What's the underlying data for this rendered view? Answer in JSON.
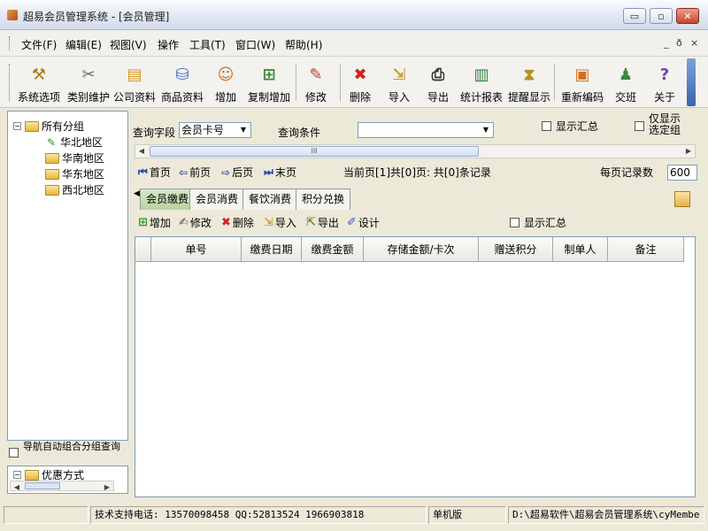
{
  "window": {
    "title": "超易会员管理系统 - [会员管理]",
    "controls": {
      "minimize": "▭",
      "restore": "▫",
      "close": "✕"
    }
  },
  "menu": {
    "items": [
      "文件(F)",
      "编辑(E)",
      "视图(V)",
      "操作",
      "工具(T)",
      "窗口(W)",
      "帮助(H)"
    ],
    "mdi_controls": [
      "_",
      "ð",
      "×"
    ]
  },
  "toolbar": {
    "buttons": [
      {
        "label": "系统选项",
        "icon": "hammer-icon"
      },
      {
        "label": "类别维护",
        "icon": "tools-icon"
      },
      {
        "label": "公司资料",
        "icon": "company-icon"
      },
      {
        "label": "商品资料",
        "icon": "goods-icon"
      },
      {
        "label": "增加",
        "icon": "add-user-icon"
      },
      {
        "label": "复制增加",
        "icon": "copy-add-icon"
      },
      {
        "label": "修改",
        "icon": "pencil-icon"
      },
      {
        "label": "删除",
        "icon": "delete-x-icon"
      },
      {
        "label": "导入",
        "icon": "import-icon"
      },
      {
        "label": "导出",
        "icon": "printer-icon"
      },
      {
        "label": "统计报表",
        "icon": "chart-icon"
      },
      {
        "label": "提醒显示",
        "icon": "reminder-icon"
      },
      {
        "label": "重新编码",
        "icon": "recode-icon"
      },
      {
        "label": "交班",
        "icon": "handover-icon"
      },
      {
        "label": "关于",
        "icon": "help-question-icon"
      }
    ]
  },
  "tree": {
    "root": "所有分组",
    "children": [
      "华北地区",
      "华南地区",
      "华东地区",
      "西北地区"
    ]
  },
  "nav_checkbox": {
    "label": "导航自动组合分组查询"
  },
  "lower_tree": {
    "root": "优惠方式"
  },
  "query": {
    "field_label": "查询字段",
    "field_value": "会员卡号",
    "condition_label": "查询条件",
    "condition_value": "",
    "show_summary_label": "显示汇总",
    "only_selected_label": "仅显示选定组"
  },
  "pager": {
    "first": "首页",
    "prev": "前页",
    "next": "后页",
    "last": "末页",
    "status": "当前页[1]共[0]页: 共[0]条记录",
    "per_page_label": "每页记录数",
    "per_page_value": "600"
  },
  "tabs": [
    "会员缴费",
    "会员消费",
    "餐饮消费",
    "积分兑换"
  ],
  "subtoolbar": {
    "add": "增加",
    "edit": "修改",
    "delete": "删除",
    "import": "导入",
    "export": "导出",
    "design": "设计",
    "show_summary": "显示汇总"
  },
  "grid": {
    "columns": [
      "单号",
      "缴费日期",
      "缴费金额",
      "存储金额/卡次",
      "赠送积分",
      "制单人",
      "备注"
    ]
  },
  "scroll": {
    "thumb_mark": "III"
  },
  "statusbar": {
    "support": "技术支持电话: 13570098458 QQ:52813524 1966903818",
    "edition": "单机版",
    "path": "D:\\超易软件\\超易会员管理系统\\cyMembe"
  }
}
